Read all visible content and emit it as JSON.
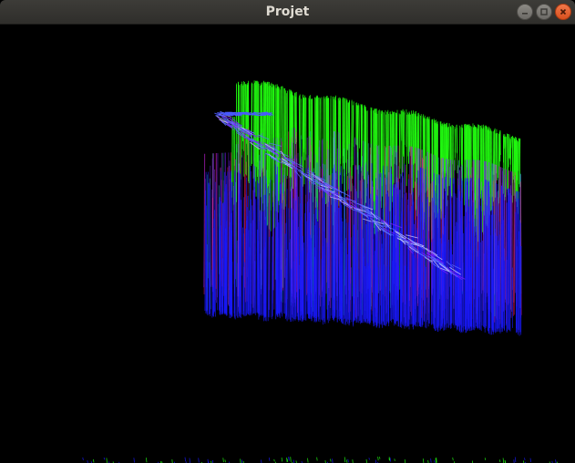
{
  "window": {
    "title": "Projet",
    "controls": [
      {
        "name": "minimize",
        "icon": "minimize-icon"
      },
      {
        "name": "maximize",
        "icon": "maximize-icon"
      },
      {
        "name": "close",
        "icon": "close-icon"
      }
    ]
  },
  "scene": {
    "background": "#000000",
    "colors": {
      "top_layer": "#22ff11",
      "middle_layer": "#7a22ff",
      "bottom_layer": "#1a1aff",
      "accent": "#ff1a66",
      "teal": "#22cccc"
    }
  }
}
